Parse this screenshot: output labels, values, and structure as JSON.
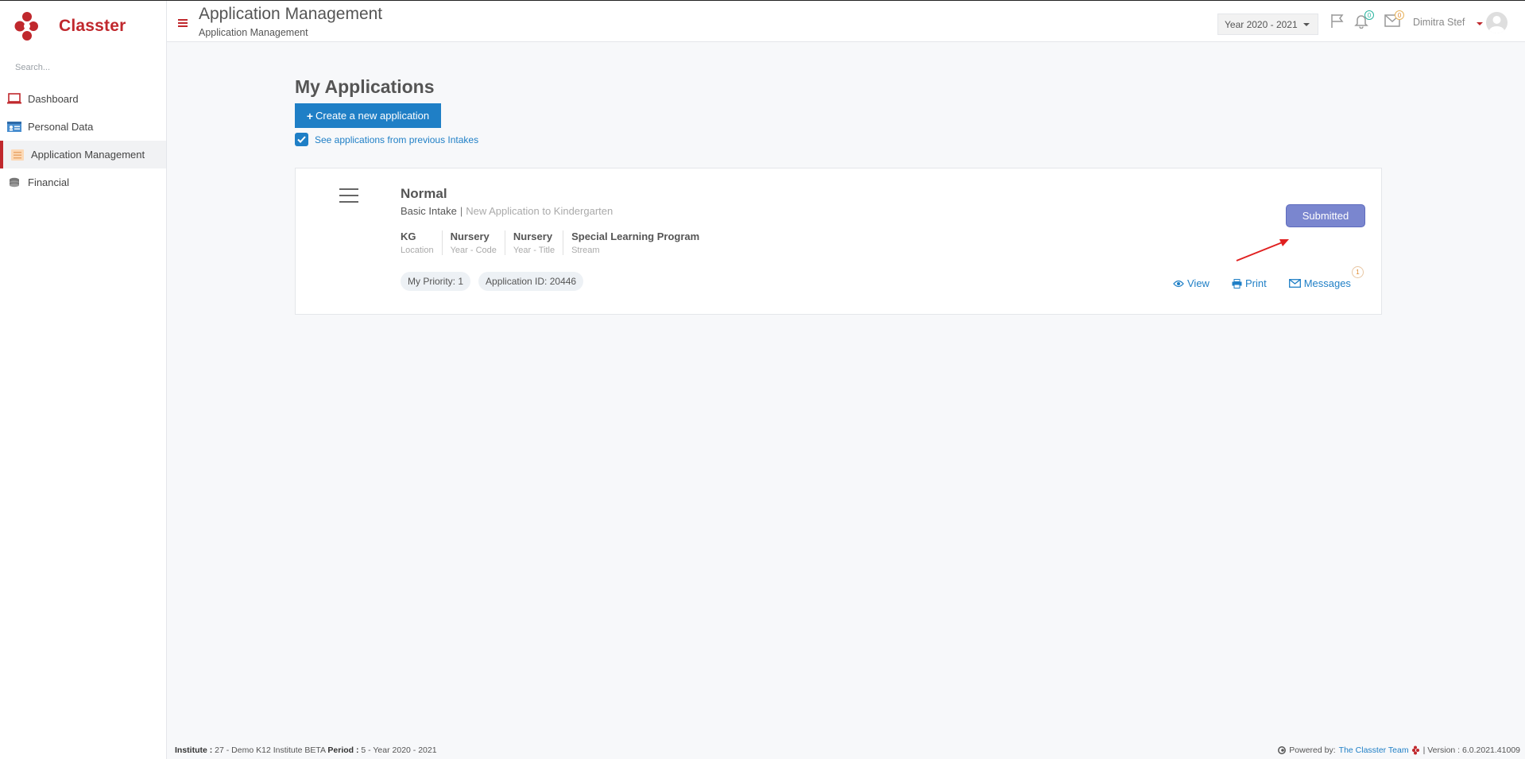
{
  "app": {
    "brand": "Classter"
  },
  "sidebar": {
    "search_placeholder": "Search...",
    "items": [
      {
        "label": "Dashboard",
        "icon": "laptop-icon"
      },
      {
        "label": "Personal Data",
        "icon": "id-card-icon"
      },
      {
        "label": "Application Management",
        "icon": "forms-icon",
        "active": true
      },
      {
        "label": "Financial",
        "icon": "coins-icon"
      }
    ]
  },
  "header": {
    "title": "Application Management",
    "subtitle": "Application Management",
    "year_select": "Year 2020 - 2021",
    "notifications_count": "0",
    "messages_count": "0",
    "user_name": "Dimitra Stef"
  },
  "main": {
    "title": "My Applications",
    "create_button": "Create a new application",
    "create_plus": "+",
    "show_previous_label": "See applications from previous Intakes",
    "show_previous_checked": true
  },
  "application": {
    "name": "Normal",
    "intake": "Basic Intake",
    "separator": "|",
    "description": "New Application to Kindergarten",
    "fields": [
      {
        "value": "KG",
        "label": "Location"
      },
      {
        "value": "Nursery",
        "label": "Year - Code"
      },
      {
        "value": "Nursery",
        "label": "Year - Title"
      },
      {
        "value": "Special Learning Program",
        "label": "Stream"
      }
    ],
    "priority": "My Priority: 1",
    "application_id": "Application ID: 20446",
    "status": "Submitted",
    "actions": {
      "view": "View",
      "print": "Print",
      "messages": "Messages",
      "messages_count": "1"
    }
  },
  "footer": {
    "institute_label": "Institute :",
    "institute_value": "27 - Demo K12 Institute BETA",
    "period_label": "Period :",
    "period_value": "5 - Year 2020 - 2021",
    "powered_by": "Powered by:",
    "team": "The Classter Team",
    "version": "| Version : 6.0.2021.41009"
  },
  "colors": {
    "brand_red": "#c0282d",
    "primary_blue": "#1f7fc6",
    "status_purple": "#7a86cf"
  }
}
